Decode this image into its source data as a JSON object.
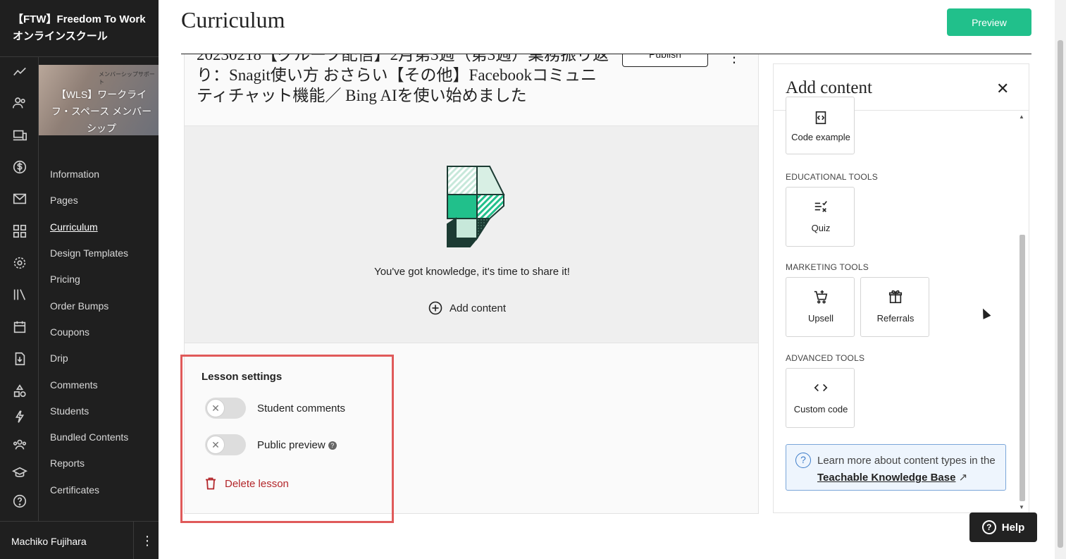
{
  "sidebar": {
    "school_name": "【FTW】Freedom To Work オンラインスクール",
    "course_thumbnail": {
      "top_text": "メンバーシップサポート",
      "title": "【WLS】ワークライフ・スペース メンバーシップ"
    },
    "nav_items": [
      {
        "label": "Information"
      },
      {
        "label": "Pages"
      },
      {
        "label": "Curriculum"
      },
      {
        "label": "Design Templates"
      },
      {
        "label": "Pricing"
      },
      {
        "label": "Order Bumps"
      },
      {
        "label": "Coupons"
      },
      {
        "label": "Drip"
      },
      {
        "label": "Comments"
      },
      {
        "label": "Students"
      },
      {
        "label": "Bundled Contents"
      },
      {
        "label": "Reports"
      },
      {
        "label": "Certificates"
      }
    ],
    "active_item": "Curriculum",
    "rail_icons": [
      "trend-icon",
      "users-icon",
      "devices-icon",
      "dollar-icon",
      "mail-icon",
      "grid-icon",
      "gear-icon",
      "library-icon",
      "calendar-icon",
      "download-icon",
      "shapes-icon",
      "bolt-icon",
      "group-icon",
      "graduation-icon",
      "help-icon"
    ],
    "user_name": "Machiko Fujihara"
  },
  "header": {
    "title": "Curriculum",
    "preview_label": "Preview"
  },
  "lesson": {
    "title": "20230218【グループ配信】2月第3週（第3週）業務振り返り：Snagit使い方 おさらい【その他】Facebookコミュニティチャット機能／ Bing AIを使い始めました",
    "publish_label": "Publish",
    "empty_message": "You've got knowledge, it's time to share it!",
    "add_content_label": "Add content"
  },
  "lesson_settings": {
    "title": "Lesson settings",
    "student_comments_label": "Student comments",
    "public_preview_label": "Public preview",
    "delete_label": "Delete lesson"
  },
  "add_content_panel": {
    "title": "Add content",
    "partial_tool": {
      "label": "Code example",
      "icon": "code-file-icon"
    },
    "sections": [
      {
        "label": "EDUCATIONAL TOOLS",
        "tools": [
          {
            "label": "Quiz",
            "icon": "quiz-icon"
          }
        ]
      },
      {
        "label": "MARKETING TOOLS",
        "tools": [
          {
            "label": "Upsell",
            "icon": "cart-plus-icon"
          },
          {
            "label": "Referrals",
            "icon": "gift-icon"
          }
        ]
      },
      {
        "label": "ADVANCED TOOLS",
        "tools": [
          {
            "label": "Custom code",
            "icon": "code-icon"
          }
        ]
      }
    ],
    "kb_text": "Learn more about content types in the",
    "kb_link": "Teachable Knowledge Base"
  },
  "help_label": "Help",
  "colors": {
    "accent": "#21c08b",
    "sidebar_bg": "#1f1f1f",
    "danger": "#b3262a",
    "highlight": "#e05a5a"
  }
}
